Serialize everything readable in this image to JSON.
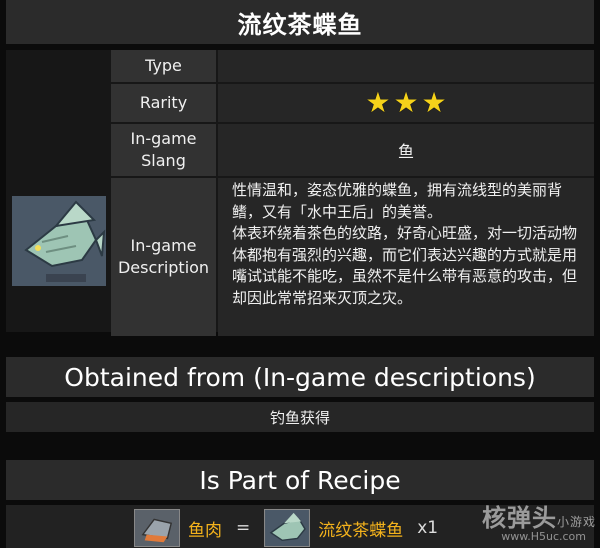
{
  "page": {
    "title": "流纹茶蝶鱼"
  },
  "info": {
    "type_label": "Type",
    "type_value": "",
    "rarity_label": "Rarity",
    "rarity_stars": 3,
    "slang_label": "In-game Slang",
    "slang_value": "鱼",
    "desc_label": "In-game Description",
    "desc_p1": "性情温和，姿态优雅的蝶鱼，拥有流线型的美丽背鳍，又有「水中王后」的美誉。",
    "desc_p2": "体表环绕着茶色的纹路，好奇心旺盛，对一切活动物体都抱有强烈的兴趣，而它们表达兴趣的方式就是用嘴试试能不能吃，虽然不是什么带有恶意的攻击，但却因此常常招来灭顶之灾。"
  },
  "obtained": {
    "heading": "Obtained from (In-game descriptions)",
    "text": "钓鱼获得"
  },
  "recipe": {
    "heading": "Is Part of Recipe",
    "ingredient": "鱼肉",
    "equals": "=",
    "result": "流纹茶蝶鱼",
    "qty": "x1"
  },
  "watermark": {
    "brand": "核弹头",
    "sub": "小游戏",
    "url": "www.H5uc.com"
  },
  "colors": {
    "star": "#f5d21a",
    "ingredient": "#f3b21c"
  },
  "icons": {
    "fish": "fish-icon",
    "meat": "fish-meat-icon",
    "star": "star-icon"
  }
}
